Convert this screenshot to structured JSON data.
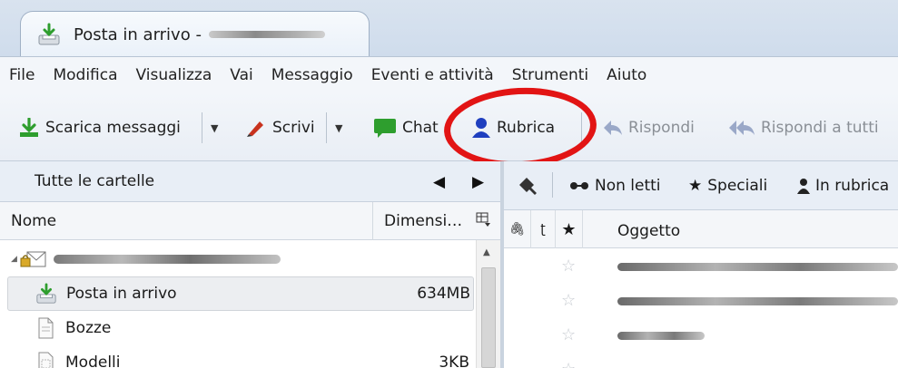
{
  "tab": {
    "title": "Posta in arrivo -",
    "icon": "inbox-download-icon"
  },
  "menu": {
    "items": [
      "File",
      "Modifica",
      "Visualizza",
      "Vai",
      "Messaggio",
      "Eventi e attività",
      "Strumenti",
      "Aiuto"
    ]
  },
  "toolbar": {
    "get_messages": "Scarica messaggi",
    "write": "Scrivi",
    "chat": "Chat",
    "address_book": "Rubrica",
    "reply": "Rispondi",
    "reply_all": "Rispondi a tutti"
  },
  "folder_pane": {
    "header": "Tutte le cartelle",
    "col_name": "Nome",
    "col_size": "Dimensi…",
    "folders": [
      {
        "name": "Posta in arrivo",
        "size": "634MB",
        "icon": "inbox-download-icon"
      },
      {
        "name": "Bozze",
        "size": "",
        "icon": "drafts-icon"
      },
      {
        "name": "Modelli",
        "size": "3KB",
        "icon": "templates-icon"
      }
    ]
  },
  "filter_bar": {
    "unread": "Non letti",
    "starred": "Speciali",
    "contacts": "In rubrica"
  },
  "message_list": {
    "col_subject": "Oggetto",
    "rows": [
      {
        "starred": false
      },
      {
        "starred": false
      },
      {
        "starred": false
      },
      {
        "starred": false
      }
    ]
  },
  "colors": {
    "highlight_ring": "#e21414",
    "accent_green": "#2e9e2e",
    "accent_blue": "#1f3fbf",
    "accent_red": "#c8321e"
  }
}
